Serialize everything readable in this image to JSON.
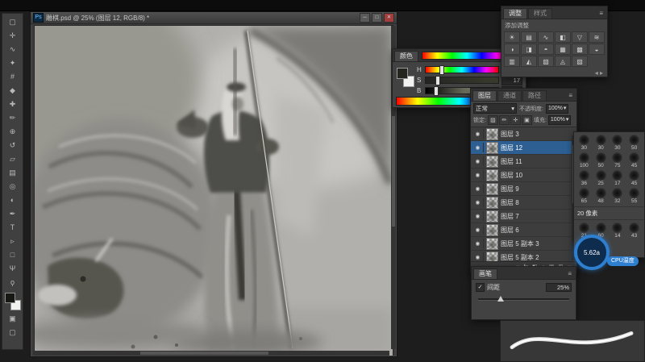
{
  "colors": {
    "selection_blue": "#2d5f93",
    "panel_bg": "#424242",
    "gauge_accent": "#2f7fd0",
    "canvas_base_gray": "#b1b0ad"
  },
  "icons": {
    "menu": "≡",
    "chevron": "▾",
    "check": "✓",
    "eye": "◉",
    "min": "─",
    "max": "□",
    "close": "✕"
  },
  "document": {
    "icon": "Ps",
    "title": "雕棋.psd @ 25% (图层 12, RGB/8) *"
  },
  "toolbar": {
    "tools": [
      {
        "name": "marquee-tool-icon",
        "glyph": "▢"
      },
      {
        "name": "move-tool-icon",
        "glyph": "✛"
      },
      {
        "name": "lasso-tool-icon",
        "glyph": "∿"
      },
      {
        "name": "quick-select-tool-icon",
        "glyph": "✦"
      },
      {
        "name": "crop-tool-icon",
        "glyph": "#"
      },
      {
        "name": "eyedropper-tool-icon",
        "glyph": "◆"
      },
      {
        "name": "healing-brush-tool-icon",
        "glyph": "✚"
      },
      {
        "name": "brush-tool-icon",
        "glyph": "✏"
      },
      {
        "name": "clone-stamp-tool-icon",
        "glyph": "⊕"
      },
      {
        "name": "history-brush-tool-icon",
        "glyph": "↺"
      },
      {
        "name": "eraser-tool-icon",
        "glyph": "▱"
      },
      {
        "name": "gradient-tool-icon",
        "glyph": "▤"
      },
      {
        "name": "blur-tool-icon",
        "glyph": "◎"
      },
      {
        "name": "dodge-tool-icon",
        "glyph": "◐"
      },
      {
        "name": "pen-tool-icon",
        "glyph": "✒"
      },
      {
        "name": "type-tool-icon",
        "glyph": "T"
      },
      {
        "name": "path-select-tool-icon",
        "glyph": "▹"
      },
      {
        "name": "shape-tool-icon",
        "glyph": "□"
      },
      {
        "name": "hand-tool-icon",
        "glyph": "Ψ"
      },
      {
        "name": "zoom-tool-icon",
        "glyph": "ϙ"
      }
    ],
    "extra": [
      {
        "name": "quick-mask-icon",
        "glyph": "▣"
      },
      {
        "name": "screen-mode-icon",
        "glyph": "▢"
      }
    ]
  },
  "color_panel": {
    "tab": "颜色",
    "sliders": [
      {
        "label": "H",
        "value": "80"
      },
      {
        "label": "S",
        "value": "17"
      },
      {
        "label": "B",
        "value": "14"
      }
    ]
  },
  "adjustments_panel": {
    "tab": "调整",
    "tab2": "样式",
    "subtitle": "添加调整",
    "arrows": "◂ ▸",
    "icons": [
      {
        "name": "brightness-contrast-icon",
        "glyph": "☀"
      },
      {
        "name": "levels-icon",
        "glyph": "▤"
      },
      {
        "name": "curves-icon",
        "glyph": "∿"
      },
      {
        "name": "exposure-icon",
        "glyph": "◧"
      },
      {
        "name": "vibrance-icon",
        "glyph": "▽"
      },
      {
        "name": "hue-saturation-icon",
        "glyph": "≋"
      },
      {
        "name": "color-balance-icon",
        "glyph": "◑"
      },
      {
        "name": "black-white-icon",
        "glyph": "◨"
      },
      {
        "name": "photo-filter-icon",
        "glyph": "◓"
      },
      {
        "name": "channel-mixer-icon",
        "glyph": "▦"
      },
      {
        "name": "color-lookup-icon",
        "glyph": "▩"
      },
      {
        "name": "invert-icon",
        "glyph": "◒"
      },
      {
        "name": "posterize-icon",
        "glyph": "▥"
      },
      {
        "name": "threshold-icon",
        "glyph": "◭"
      },
      {
        "name": "gradient-map-icon",
        "glyph": "▧"
      },
      {
        "name": "selective-color-icon",
        "glyph": "◬"
      },
      {
        "name": "custom-preset-icon",
        "glyph": "▨"
      }
    ]
  },
  "layers_panel": {
    "tabs": [
      "图层",
      "通道",
      "路径"
    ],
    "blend_mode": "正常",
    "opacity_label": "不透明度:",
    "opacity_value": "100%",
    "lock_label": "锁定:",
    "fill_label": "填充:",
    "fill_value": "100%",
    "lock_icons": [
      {
        "name": "lock-transparency-icon",
        "glyph": "▨"
      },
      {
        "name": "lock-paint-icon",
        "glyph": "✏"
      },
      {
        "name": "lock-position-icon",
        "glyph": "✛"
      },
      {
        "name": "lock-all-icon",
        "glyph": "▣"
      }
    ],
    "layers": [
      {
        "name": "图层 3",
        "selected": false
      },
      {
        "name": "图层 12",
        "selected": true
      },
      {
        "name": "图层 11",
        "selected": false
      },
      {
        "name": "图层 10",
        "selected": false
      },
      {
        "name": "图层 9",
        "selected": false
      },
      {
        "name": "图层 8",
        "selected": false
      },
      {
        "name": "图层 7",
        "selected": false
      },
      {
        "name": "图层 6",
        "selected": false
      },
      {
        "name": "图层 5 副本 3",
        "selected": false
      },
      {
        "name": "图层 5 副本 2",
        "selected": false
      }
    ],
    "footer_icons": [
      {
        "name": "link-layers-icon",
        "glyph": "∞"
      },
      {
        "name": "layer-style-icon",
        "glyph": "fx"
      },
      {
        "name": "layer-mask-icon",
        "glyph": "◧"
      },
      {
        "name": "adjustment-layer-icon",
        "glyph": "◑"
      },
      {
        "name": "layer-group-icon",
        "glyph": "▣"
      },
      {
        "name": "new-layer-icon",
        "glyph": "⊞"
      },
      {
        "name": "delete-layer-icon",
        "glyph": "▭"
      }
    ]
  },
  "brush_panel": {
    "presets": [
      {
        "size": "30"
      },
      {
        "size": "30"
      },
      {
        "size": "30"
      },
      {
        "size": "50"
      },
      {
        "size": "100"
      },
      {
        "size": "50"
      },
      {
        "size": "75"
      },
      {
        "size": "45"
      },
      {
        "size": "36"
      },
      {
        "size": "25"
      },
      {
        "size": "17"
      },
      {
        "size": "45"
      },
      {
        "size": "65"
      },
      {
        "size": "48"
      },
      {
        "size": "32"
      },
      {
        "size": "55"
      }
    ],
    "size_label": "20 像素",
    "extra_presets": [
      {
        "size": "21"
      },
      {
        "size": "60"
      },
      {
        "size": "14"
      },
      {
        "size": "43"
      }
    ]
  },
  "gauge": {
    "value": "5.62a",
    "label": "CPU温度"
  },
  "brush_settings": {
    "tab": "画笔",
    "spacing_label": "间距",
    "spacing_value": "25%"
  }
}
